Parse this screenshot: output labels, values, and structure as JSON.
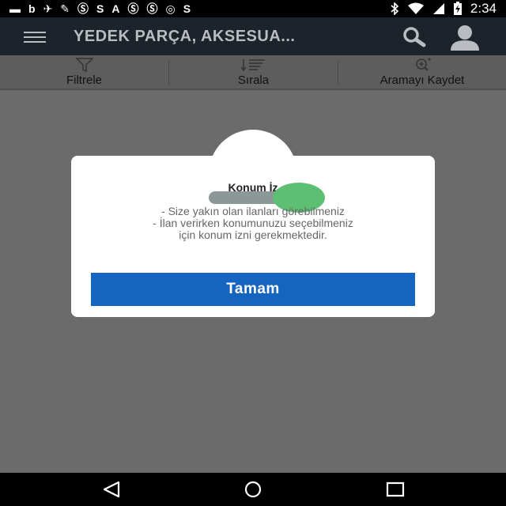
{
  "status_bar": {
    "left_icons": [
      "message-icon",
      "b-icon",
      "bird-icon",
      "wrench-icon",
      "sf-icon",
      "s-icon",
      "a-icon",
      "sf-icon",
      "sf-icon",
      "yoo-icon",
      "s-icon"
    ],
    "left_glyphs": [
      "▬",
      "b",
      "✈",
      "✎",
      "Ⓢ",
      "S",
      "A",
      "Ⓢ",
      "Ⓢ",
      "◎",
      "S"
    ],
    "right_icons": [
      "bluetooth-icon",
      "wifi-icon",
      "signal-icon",
      "battery-icon"
    ],
    "time": "2:34"
  },
  "app_bar": {
    "title": "YEDEK PARÇA, AKSESUA...",
    "title_color": "#b9bcc0",
    "background": "#1c232b"
  },
  "toolbar": {
    "filter_label": "Filtrele",
    "sort_label": "Sırala",
    "save_search_label": "Aramayı Kaydet"
  },
  "dialog": {
    "title": "Konum İz",
    "lines": [
      "- Size yakın olan ilanları görebilmeniz",
      "- İlan verirken konumunuzu seçebilmeniz",
      "için konum izni gerekmektedir."
    ],
    "button_label": "Tamam",
    "button_color": "#1565c0",
    "toggle_on": true,
    "toggle_color": "#5cbf74"
  },
  "nav_bar": {
    "buttons": [
      "back-icon",
      "home-icon",
      "recents-icon"
    ]
  }
}
